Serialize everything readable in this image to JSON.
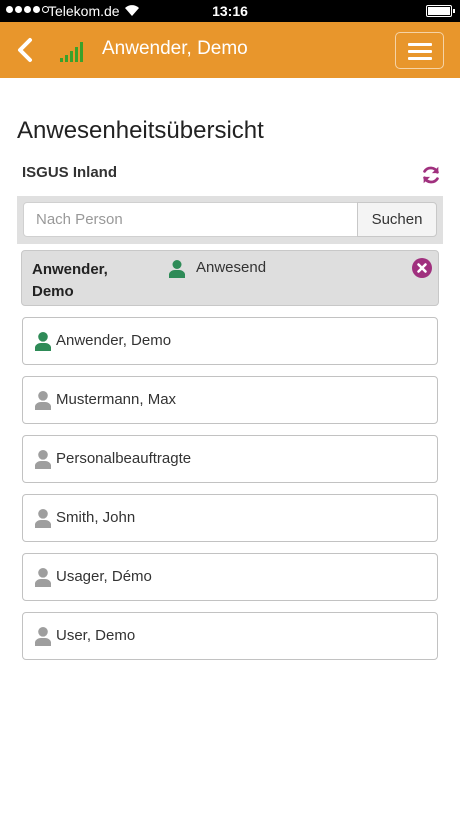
{
  "statusbar": {
    "carrier": "Telekom.de",
    "time": "13:16",
    "signal_dots": [
      true,
      true,
      true,
      true,
      false
    ]
  },
  "header": {
    "title": "Anwender, Demo"
  },
  "page": {
    "title": "Anwesenheitsübersicht",
    "section": "ISGUS Inland"
  },
  "search": {
    "placeholder": "Nach Person",
    "value": "",
    "button_label": "Suchen"
  },
  "selected": {
    "name": "Anwender, Demo",
    "status": "Anwesend",
    "status_color": "#2e8b57"
  },
  "colors": {
    "accent": "#e8962c",
    "present": "#2e8b57",
    "absent": "#9e9e9e",
    "action": "#a0307e"
  },
  "persons": [
    {
      "name": "Anwender, Demo",
      "present": true
    },
    {
      "name": "Mustermann, Max",
      "present": false
    },
    {
      "name": "Personalbeauftragte",
      "present": false
    },
    {
      "name": "Smith, John",
      "present": false
    },
    {
      "name": "Usager, Démo",
      "present": false
    },
    {
      "name": "User, Demo",
      "present": false
    }
  ]
}
